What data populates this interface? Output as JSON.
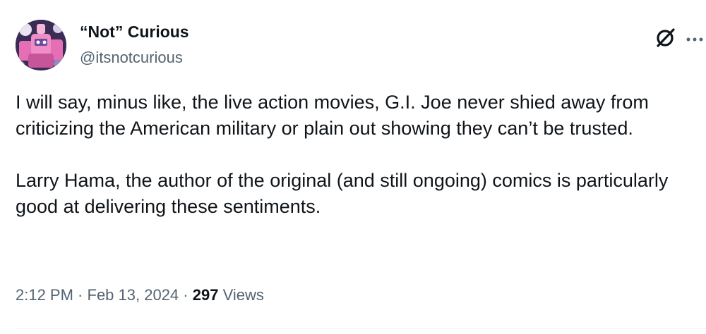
{
  "author": {
    "display_name": "“Not” Curious",
    "handle": "@itsnotcurious",
    "avatar_icon": "avatar-illustration"
  },
  "actions": {
    "grok_icon": "grok-slash-icon",
    "more_icon": "more-horizontal-icon"
  },
  "tweet": {
    "paragraphs": [
      "I will say, minus like, the live action movies, G.I. Joe never shied away from criticizing the American military or plain out showing they can’t be trusted.",
      "Larry Hama, the author of the original (and still ongoing) comics is particularly good at delivering these sentiments."
    ]
  },
  "meta": {
    "time": "2:12 PM",
    "separator": " · ",
    "date": "Feb 13, 2024",
    "views_count": "297",
    "views_label": " Views"
  },
  "colors": {
    "primary_text": "#0f1419",
    "secondary_text": "#536471",
    "divider": "#eff3f4"
  }
}
